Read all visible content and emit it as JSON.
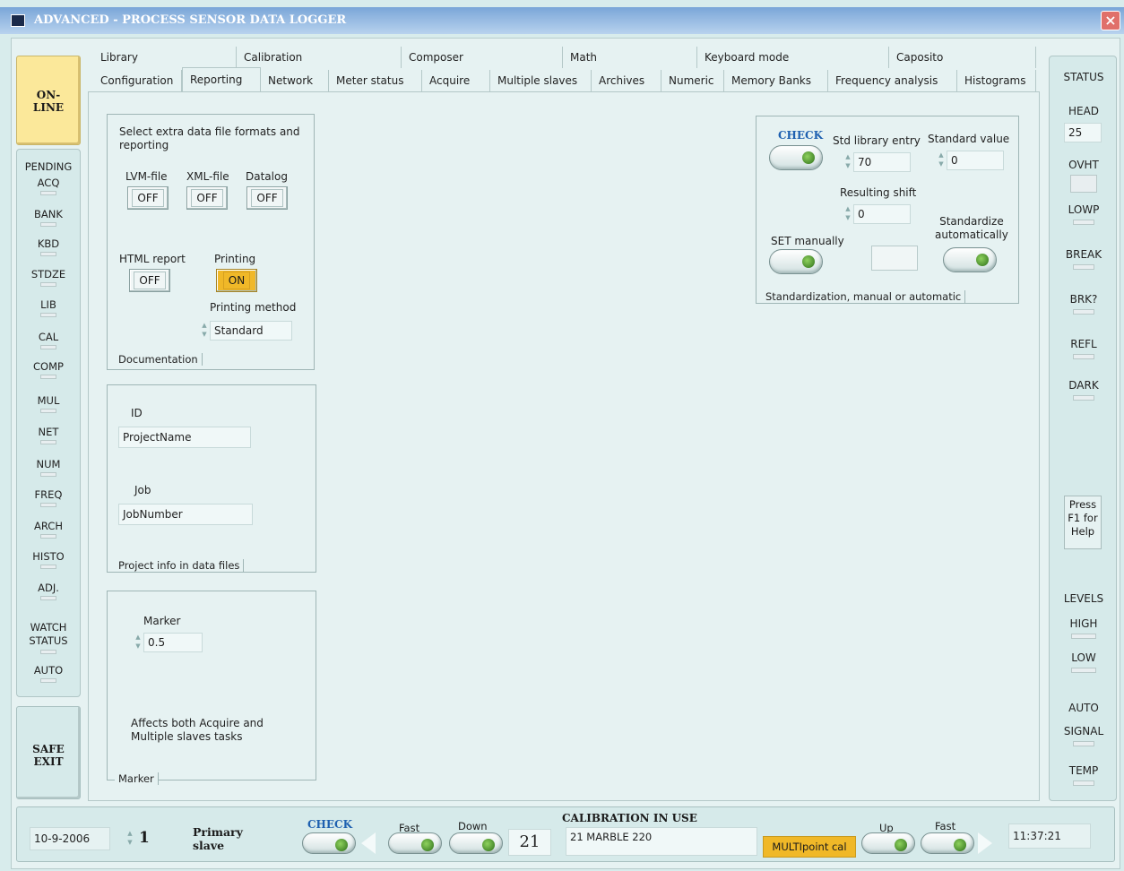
{
  "window": {
    "title": "ADVANCED - PROCESS SENSOR DATA LOGGER",
    "close": "×"
  },
  "left": {
    "online": [
      "ON-",
      "LINE"
    ],
    "pending_label": "PENDING",
    "pending_items": [
      "ACQ",
      "BANK",
      "KBD",
      "STDZE",
      "LIB",
      "CAL",
      "COMP",
      "MUL",
      "NET",
      "NUM",
      "FREQ",
      "ARCH",
      "HISTO",
      "ADJ."
    ],
    "watch_status": [
      "WATCH",
      "STATUS"
    ],
    "auto": "AUTO",
    "safe_exit": [
      "SAFE",
      "EXIT"
    ]
  },
  "tabs": {
    "row1": [
      "Library",
      "Calibration",
      "Composer",
      "Math",
      "Keyboard mode",
      "Caposito"
    ],
    "row2": [
      "Configuration",
      "Reporting",
      "Network",
      "Meter status",
      "Acquire",
      "Multiple slaves",
      "Archives",
      "Numeric",
      "Memory Banks",
      "Frequency analysis",
      "Histograms"
    ],
    "selected": "Reporting"
  },
  "documentation": {
    "intro": [
      "Select extra data file formats and",
      "reporting"
    ],
    "lvm_label": "LVM-file",
    "lvm_value": "OFF",
    "xml_label": "XML-file",
    "xml_value": "OFF",
    "datalog_label": "Datalog",
    "datalog_value": "OFF",
    "html_label": "HTML report",
    "html_value": "OFF",
    "printing_label": "Printing",
    "printing_value": "ON",
    "method_label": "Printing method",
    "method_value": "Standard",
    "group": "Documentation"
  },
  "project": {
    "id_label": "ID",
    "id_value": "ProjectName",
    "job_label": "Job",
    "job_value": "JobNumber",
    "group": "Project info in data files"
  },
  "marker": {
    "label": "Marker",
    "value": "0.5",
    "note": [
      "Affects both Acquire and",
      "Multiple slaves tasks"
    ],
    "group": "Marker"
  },
  "standardization": {
    "check": "CHECK",
    "std_label": "Std library entry",
    "std_value": "70",
    "stdval_label": "Standard value",
    "stdval_value": "0",
    "shift_label": "Resulting shift",
    "shift_value": "0",
    "set_label": "SET manually",
    "auto_label": [
      "Standardize",
      "automatically"
    ],
    "group": "Standardization, manual or automatic"
  },
  "status": {
    "title": "STATUS",
    "head_label": "HEAD",
    "head_value": "25",
    "items": [
      "OVHT",
      "LOWP",
      "BREAK",
      "BRK?",
      "REFL",
      "DARK"
    ],
    "help": [
      "Press",
      "F1 for",
      "Help"
    ],
    "levels": "LEVELS",
    "level_items": [
      "HIGH",
      "LOW"
    ],
    "auto": "AUTO",
    "auto_items": [
      "SIGNAL",
      "TEMP"
    ]
  },
  "bottom": {
    "date": "10-9-2006",
    "slave_number": "1",
    "slave_label": [
      "Primary",
      "slave"
    ],
    "check": "CHECK",
    "fast_left": "Fast",
    "down": "Down",
    "counter": "21",
    "calibration_title": "CALIBRATION IN USE",
    "calibration_value": "21 MARBLE 220",
    "cal_mode": "MULTIpoint cal",
    "up": "Up",
    "fast_right": "Fast",
    "time": "11:37:21"
  }
}
